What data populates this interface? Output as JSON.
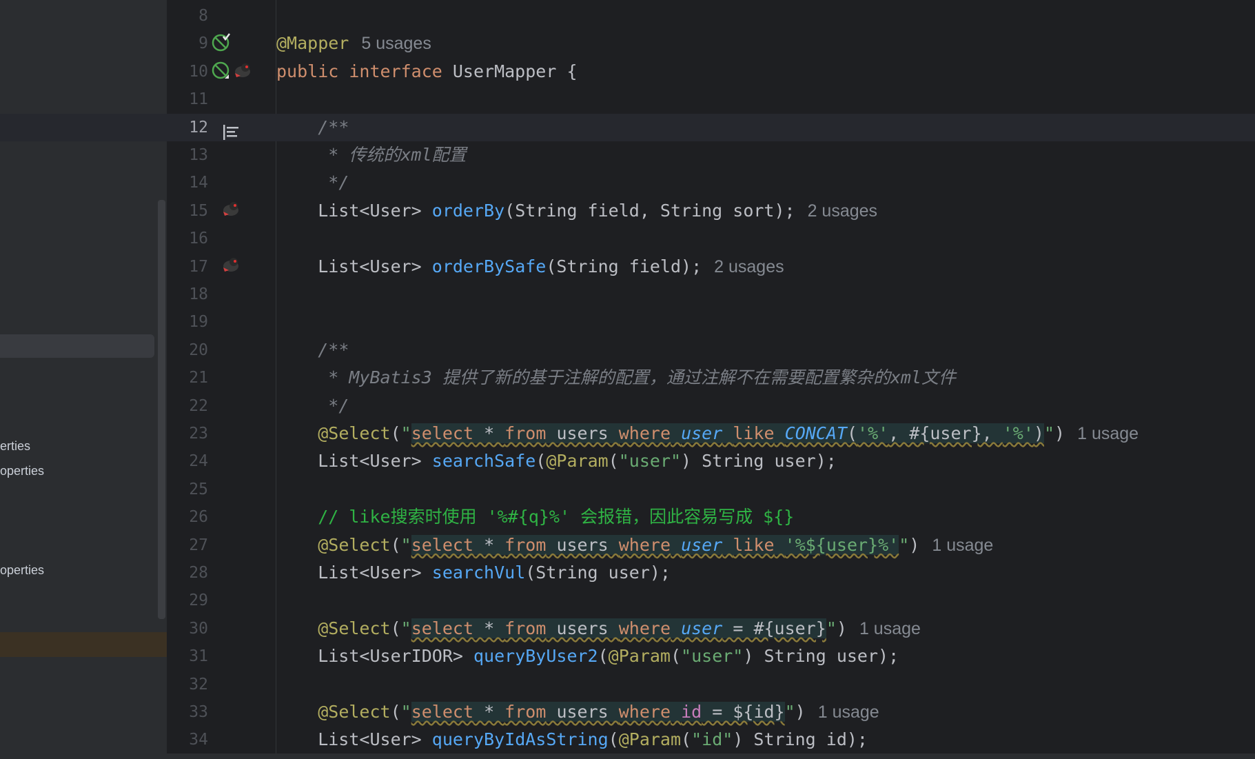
{
  "sidebar": {
    "items": [
      "erties",
      "operties",
      "operties"
    ]
  },
  "editor": {
    "lines": [
      {
        "n": "8",
        "html": ""
      },
      {
        "n": "9",
        "html": "<span class=\"ann\">@Mapper</span><span class=\"hint\">5 usages</span>"
      },
      {
        "n": "10",
        "html": "<span class=\"kw\">public interface </span>UserMapper {"
      },
      {
        "n": "11",
        "html": ""
      },
      {
        "n": "12",
        "html": "    <span class=\"cmt\">/**</span>"
      },
      {
        "n": "13",
        "html": "     <span class=\"cmt\">* 传统的xml配置</span>"
      },
      {
        "n": "14",
        "html": "     <span class=\"cmt\">*/</span>"
      },
      {
        "n": "15",
        "html": "    List&lt;User&gt; <span class=\"fn\">orderBy</span>(String field, String sort);<span class=\"hint\">2 usages</span>"
      },
      {
        "n": "16",
        "html": ""
      },
      {
        "n": "17",
        "html": "    List&lt;User&gt; <span class=\"fn\">orderBySafe</span>(String field);<span class=\"hint\">2 usages</span>"
      },
      {
        "n": "18",
        "html": ""
      },
      {
        "n": "19",
        "html": ""
      },
      {
        "n": "20",
        "html": "    <span class=\"cmt\">/**</span>"
      },
      {
        "n": "21",
        "html": "     <span class=\"cmt\">* MyBatis3 提供了新的基于注解的配置，通过注解不在需要配置繁杂的xml文件</span>"
      },
      {
        "n": "22",
        "html": "     <span class=\"cmt\">*/</span>"
      },
      {
        "n": "23",
        "html": "    <span class=\"ann\">@Select</span>(<span class=\"str\">\"</span><span class=\"sql\"><span class=\"sqlkw\">select</span> * <span class=\"sqlkw\">from</span> users <span class=\"sqlkw\">where</span> <span class=\"sqlcol\">user</span> <span class=\"sqlkw\">like</span> <span class=\"fnit\">CONCAT</span>(<span class=\"str\">'%'</span>, #{user}, <span class=\"str\">'%'</span>)</span><span class=\"str\">\"</span>)<span class=\"hint\">1 usage</span>"
      },
      {
        "n": "24",
        "html": "    List&lt;User&gt; <span class=\"fn\">searchSafe</span>(<span class=\"ann\">@Param</span>(<span class=\"str\">\"user\"</span>) String user);"
      },
      {
        "n": "25",
        "html": ""
      },
      {
        "n": "26",
        "html": "    <span class=\"lcmt\">// like搜索时使用 '%#{q}%' 会报错，因此容易写成 ${}</span>"
      },
      {
        "n": "27",
        "html": "    <span class=\"ann\">@Select</span>(<span class=\"str\">\"</span><span class=\"sql\"><span class=\"sqlkw\">select</span> * <span class=\"sqlkw\">from</span> users <span class=\"sqlkw\">where</span> <span class=\"sqlcol\">user</span> <span class=\"sqlkw\">like</span> <span class=\"str\">'%${user}%'</span></span><span class=\"str\">\"</span>)<span class=\"hint\">1 usage</span>"
      },
      {
        "n": "28",
        "html": "    List&lt;User&gt; <span class=\"fn\">searchVul</span>(String user);"
      },
      {
        "n": "29",
        "html": ""
      },
      {
        "n": "30",
        "html": "    <span class=\"ann\">@Select</span>(<span class=\"str\">\"</span><span class=\"sql\"><span class=\"sqlkw\">select</span> * <span class=\"sqlkw\">from</span> users <span class=\"sqlkw\">where</span> <span class=\"sqlcol\">user</span> = #{user}</span><span class=\"str\">\"</span>)<span class=\"hint\">1 usage</span>"
      },
      {
        "n": "31",
        "html": "    List&lt;UserIDOR&gt; <span class=\"fn\">queryByUser2</span>(<span class=\"ann\">@Param</span>(<span class=\"str\">\"user\"</span>) String user);"
      },
      {
        "n": "32",
        "html": ""
      },
      {
        "n": "33",
        "html": "    <span class=\"ann\">@Select</span>(<span class=\"str\">\"</span><span class=\"sql\"><span class=\"sqlkw\">select</span> * <span class=\"sqlkw\">from</span> users <span class=\"sqlkw\">where</span> <span class=\"sqlid\">id</span> = ${id}</span><span class=\"str\">\"</span>)<span class=\"hint\">1 usage</span>"
      },
      {
        "n": "34",
        "html": "    List&lt;User&gt; <span class=\"fn\">queryByIdAsString</span>(<span class=\"ann\">@Param</span>(<span class=\"str\">\"id\"</span>) String id);"
      }
    ]
  },
  "colors": {
    "background": "#1e1f22",
    "keyword": "#cf8e6d",
    "annotation": "#b3ae60",
    "method": "#56a8f5",
    "string": "#6aab73",
    "comment": "#7a7e85",
    "line_comment": "#2fb344"
  }
}
